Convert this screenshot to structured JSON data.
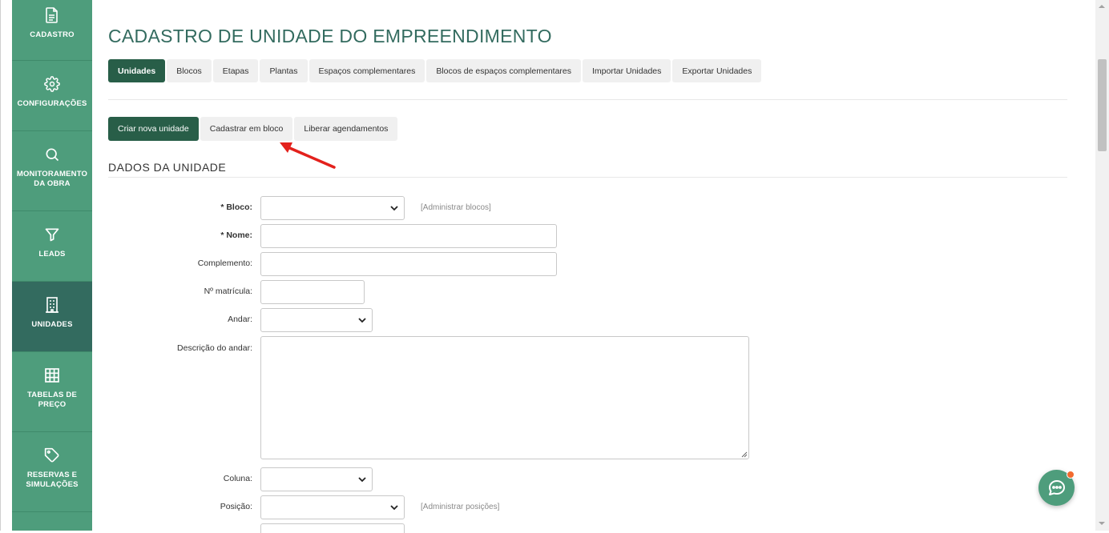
{
  "sidebar": {
    "items": [
      {
        "label": "CADASTRO",
        "icon": "document-icon",
        "active": false
      },
      {
        "label": "CONFIGURAÇÕES",
        "icon": "gear-icon",
        "active": false
      },
      {
        "label": "MONITORAMENTO\nDA OBRA",
        "icon": "search-icon",
        "active": false
      },
      {
        "label": "LEADS",
        "icon": "funnel-icon",
        "active": false
      },
      {
        "label": "UNIDADES",
        "icon": "building-icon",
        "active": true
      },
      {
        "label": "TABELAS DE\nPREÇO",
        "icon": "grid-icon",
        "active": false
      },
      {
        "label": "RESERVAS E\nSIMULAÇÕES",
        "icon": "tag-icon",
        "active": false
      }
    ]
  },
  "page": {
    "title": "CADASTRO DE UNIDADE DO EMPREENDIMENTO"
  },
  "tabs": [
    {
      "label": "Unidades",
      "active": true
    },
    {
      "label": "Blocos",
      "active": false
    },
    {
      "label": "Etapas",
      "active": false
    },
    {
      "label": "Plantas",
      "active": false
    },
    {
      "label": "Espaços complementares",
      "active": false
    },
    {
      "label": "Blocos de espaços complementares",
      "active": false
    },
    {
      "label": "Importar Unidades",
      "active": false
    },
    {
      "label": "Exportar Unidades",
      "active": false
    }
  ],
  "actions": {
    "create": "Criar nova unidade",
    "bulk": "Cadastrar em bloco",
    "release": "Liberar agendamentos"
  },
  "form": {
    "section_title": "DADOS DA UNIDADE",
    "bloco_label": "* Bloco:",
    "bloco_value": "",
    "admin_blocos": "[Administrar blocos]",
    "nome_label": "* Nome:",
    "nome_value": "",
    "complemento_label": "Complemento:",
    "complemento_value": "",
    "matricula_label": "Nº matrícula:",
    "matricula_value": "",
    "andar_label": "Andar:",
    "andar_value": "",
    "descricao_label": "Descrição do andar:",
    "descricao_value": "",
    "coluna_label": "Coluna:",
    "coluna_value": "",
    "posicao_label": "Posição:",
    "posicao_value": "",
    "admin_posicoes": "[Administrar posições]"
  },
  "colors": {
    "sidebar": "#4e9d7c",
    "sidebar_active": "#336b5f",
    "primary": "#285e48",
    "title": "#336b5f",
    "annotation_arrow": "#e3211c",
    "notification": "#f26a2e"
  }
}
